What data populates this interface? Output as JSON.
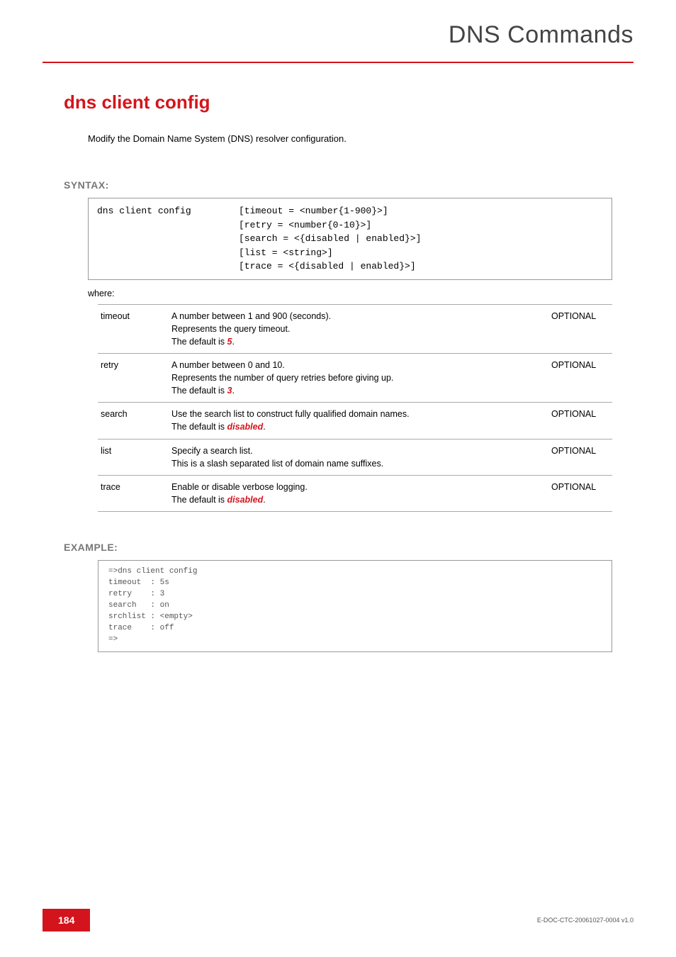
{
  "header": {
    "title": "DNS Commands"
  },
  "command": {
    "title": "dns client config",
    "description": "Modify the Domain Name System (DNS) resolver configuration."
  },
  "syntax": {
    "label": "SYNTAX:",
    "cmd": "dns client config",
    "args_l1": "[timeout = <number{1-900}>]",
    "args_l2": "[retry = <number{0-10}>]",
    "args_l3": "[search = <{disabled | enabled}>]",
    "args_l4": "[list = <string>]",
    "args_l5": "[trace = <{disabled | enabled}>]",
    "where": "where:"
  },
  "params": [
    {
      "name": "timeout",
      "desc_l1": "A number between 1 and 900 (seconds).",
      "desc_l2": "Represents the query timeout.",
      "desc_l3a": "The default is ",
      "desc_l3b": "5",
      "desc_l3c": ".",
      "opt": "OPTIONAL"
    },
    {
      "name": "retry",
      "desc_l1": "A number between 0 and 10.",
      "desc_l2": "Represents the number of query retries before giving up.",
      "desc_l3a": "The default is ",
      "desc_l3b": "3",
      "desc_l3c": ".",
      "opt": "OPTIONAL"
    },
    {
      "name": "search",
      "desc_l1": "Use the search list to construct fully qualified domain names.",
      "desc_l2a": "The default is ",
      "desc_l2b": "disabled",
      "desc_l2c": ".",
      "opt": "OPTIONAL"
    },
    {
      "name": "list",
      "desc_l1": "Specify a search list.",
      "desc_l2": "This is a slash separated list of domain name suffixes.",
      "opt": "OPTIONAL"
    },
    {
      "name": "trace",
      "desc_l1": "Enable or disable verbose logging.",
      "desc_l2a": "The default is ",
      "desc_l2b": "disabled",
      "desc_l2c": ".",
      "opt": "OPTIONAL"
    }
  ],
  "example": {
    "label": "EXAMPLE:",
    "l1": "=>dns client config",
    "l2": "timeout  : 5s",
    "l3": "retry    : 3",
    "l4": "search   : on",
    "l5": "srchlist : <empty>",
    "l6": "trace    : off",
    "l7": "=>"
  },
  "footer": {
    "page": "184",
    "docid": "E-DOC-CTC-20061027-0004 v1.0"
  }
}
